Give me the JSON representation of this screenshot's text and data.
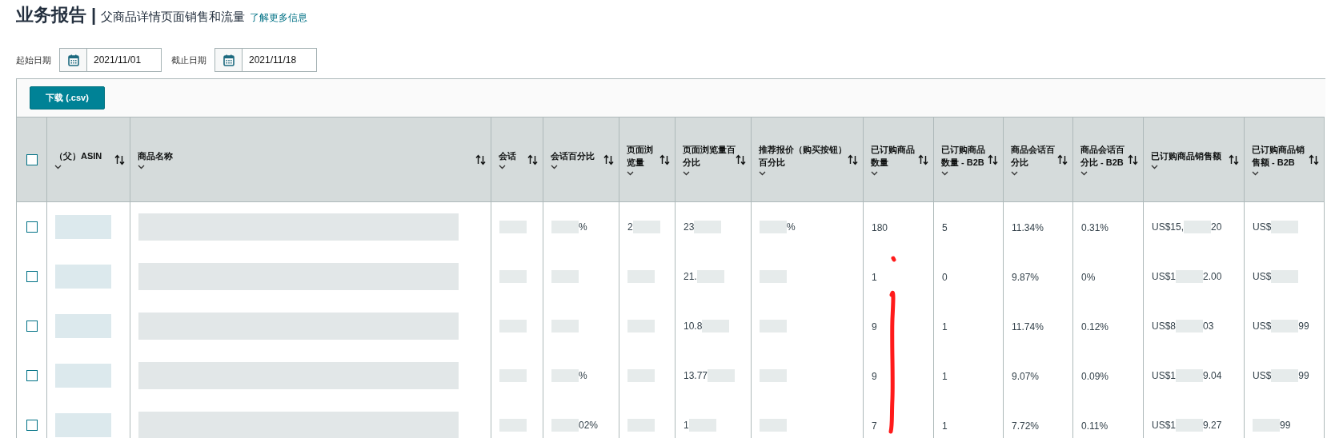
{
  "header": {
    "title": "业务报告",
    "separator": "|",
    "subtitle": "父商品详情页面销售和流量",
    "link": "了解更多信息"
  },
  "date_filters": [
    {
      "label": "起始日期",
      "value": "2021/11/01"
    },
    {
      "label": "截止日期",
      "value": "2021/11/18"
    }
  ],
  "download_button": "下载 (.csv)",
  "table": {
    "select_all": {
      "checked": false
    },
    "columns": [
      "（父）ASIN",
      "商品名称",
      "会话",
      "会话百分比",
      "页面浏览量",
      "页面浏览量百分比",
      "推荐报价（购买按钮）百分比",
      "已订购商品数量",
      "已订购商品数量 - B2B",
      "商品会话百分比",
      "商品会话百分比 - B2B",
      "已订购商品销售额",
      "已订购商品销售额 - B2B"
    ],
    "rows": [
      {
        "checked": false,
        "cells": [
          [
            null
          ],
          [
            null
          ],
          [
            null
          ],
          [
            null,
            "%"
          ],
          [
            "2",
            null
          ],
          [
            "23",
            null
          ],
          [
            null,
            "%"
          ],
          [
            "180"
          ],
          [
            "5"
          ],
          [
            "11.34%"
          ],
          [
            "0.31%"
          ],
          [
            "US$15,",
            null,
            "20"
          ],
          [
            "US$",
            null
          ]
        ]
      },
      {
        "checked": false,
        "cells": [
          [
            null
          ],
          [
            null
          ],
          [
            null
          ],
          [
            null
          ],
          [
            null
          ],
          [
            "21.",
            null
          ],
          [
            null
          ],
          [
            "1"
          ],
          [
            "0"
          ],
          [
            "9.87%"
          ],
          [
            "0%"
          ],
          [
            "US$1",
            null,
            "2.00"
          ],
          [
            "US$",
            null
          ]
        ]
      },
      {
        "checked": false,
        "cells": [
          [
            null
          ],
          [
            null
          ],
          [
            null
          ],
          [
            null
          ],
          [
            null
          ],
          [
            "10.8",
            null
          ],
          [
            null
          ],
          [
            "9"
          ],
          [
            "1"
          ],
          [
            "11.74%"
          ],
          [
            "0.12%"
          ],
          [
            "US$8",
            null,
            "03"
          ],
          [
            "US$",
            null,
            "99"
          ]
        ]
      },
      {
        "checked": false,
        "cells": [
          [
            null
          ],
          [
            null
          ],
          [
            null
          ],
          [
            null,
            "%"
          ],
          [
            null
          ],
          [
            "13.77",
            null
          ],
          [
            null
          ],
          [
            "9"
          ],
          [
            "1"
          ],
          [
            "9.07%"
          ],
          [
            "0.09%"
          ],
          [
            "US$1",
            null,
            "9.04"
          ],
          [
            "US$",
            null,
            "99"
          ]
        ]
      },
      {
        "checked": false,
        "cells": [
          [
            null
          ],
          [
            null
          ],
          [
            null
          ],
          [
            null,
            "02%"
          ],
          [
            null
          ],
          [
            "1",
            null
          ],
          [
            null
          ],
          [
            "7"
          ],
          [
            "1"
          ],
          [
            "7.72%"
          ],
          [
            "0.11%"
          ],
          [
            "US$1",
            null,
            "9.27"
          ],
          [
            null,
            "99"
          ]
        ]
      }
    ]
  }
}
